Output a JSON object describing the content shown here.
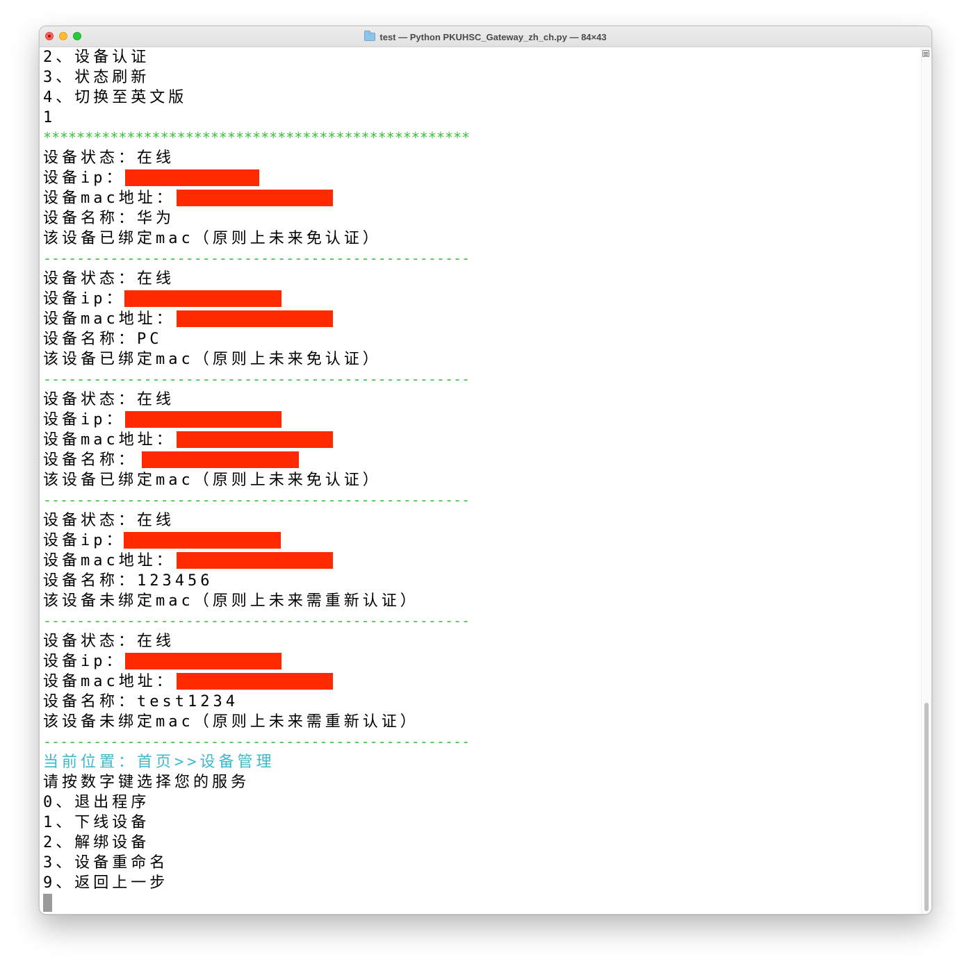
{
  "window": {
    "title": "test — Python PKUHSC_Gateway_zh_ch.py — 84×43"
  },
  "terminal": {
    "lines": [
      {
        "text": "2、设备认证",
        "style": "normal"
      },
      {
        "text": "3、状态刷新",
        "style": "normal"
      },
      {
        "text": "4、切换至英文版",
        "style": "normal"
      },
      {
        "text": "1",
        "style": "normal"
      },
      {
        "text": "***************************************************",
        "style": "green"
      },
      {
        "text": "设备状态：在线",
        "style": "normal"
      },
      {
        "text": "设备ip：",
        "style": "normal",
        "redact": [
          179,
          372
        ]
      },
      {
        "text": "设备mac地址：",
        "style": "normal",
        "redact": [
          253,
          478
        ]
      },
      {
        "text": "设备名称：华为",
        "style": "normal"
      },
      {
        "text": "该设备已绑定mac（原则上未来免认证）",
        "style": "normal"
      },
      {
        "text": "---------------------------------------------------",
        "style": "green"
      },
      {
        "text": "设备状态：在线",
        "style": "normal"
      },
      {
        "text": "设备ip：",
        "style": "normal",
        "redact": [
          178,
          404
        ]
      },
      {
        "text": "设备mac地址：",
        "style": "normal",
        "redact": [
          253,
          478
        ]
      },
      {
        "text": "设备名称：PC",
        "style": "normal"
      },
      {
        "text": "该设备已绑定mac（原则上未来免认证）",
        "style": "normal"
      },
      {
        "text": "---------------------------------------------------",
        "style": "green"
      },
      {
        "text": "设备状态：在线",
        "style": "normal"
      },
      {
        "text": "设备ip：",
        "style": "normal",
        "redact": [
          179,
          404
        ]
      },
      {
        "text": "设备mac地址：",
        "style": "normal",
        "redact": [
          253,
          478
        ]
      },
      {
        "text": "设备名称：",
        "style": "normal",
        "redact": [
          203,
          429
        ]
      },
      {
        "text": "该设备已绑定mac（原则上未来免认证）",
        "style": "normal"
      },
      {
        "text": "---------------------------------------------------",
        "style": "green"
      },
      {
        "text": "设备状态：在线",
        "style": "normal"
      },
      {
        "text": "设备ip：",
        "style": "normal",
        "redact": [
          177,
          403
        ]
      },
      {
        "text": "设备mac地址：",
        "style": "normal",
        "redact": [
          253,
          478
        ]
      },
      {
        "text": "设备名称：123456",
        "style": "normal"
      },
      {
        "text": "该设备未绑定mac（原则上未来需重新认证）",
        "style": "normal"
      },
      {
        "text": "---------------------------------------------------",
        "style": "green"
      },
      {
        "text": "设备状态：在线",
        "style": "normal"
      },
      {
        "text": "设备ip：",
        "style": "normal",
        "redact": [
          179,
          404
        ]
      },
      {
        "text": "设备mac地址：",
        "style": "normal",
        "redact": [
          253,
          478
        ]
      },
      {
        "text": "设备名称：test1234",
        "style": "normal"
      },
      {
        "text": "该设备未绑定mac（原则上未来需重新认证）",
        "style": "normal"
      },
      {
        "text": "---------------------------------------------------",
        "style": "green"
      },
      {
        "text": "当前位置：首页>>设备管理",
        "style": "cyan"
      },
      {
        "text": "请按数字键选择您的服务",
        "style": "normal"
      },
      {
        "text": "0、退出程序",
        "style": "normal"
      },
      {
        "text": "1、下线设备",
        "style": "normal"
      },
      {
        "text": "2、解绑设备",
        "style": "normal"
      },
      {
        "text": "3、设备重命名",
        "style": "normal"
      },
      {
        "text": "9、返回上一步",
        "style": "normal"
      }
    ]
  }
}
